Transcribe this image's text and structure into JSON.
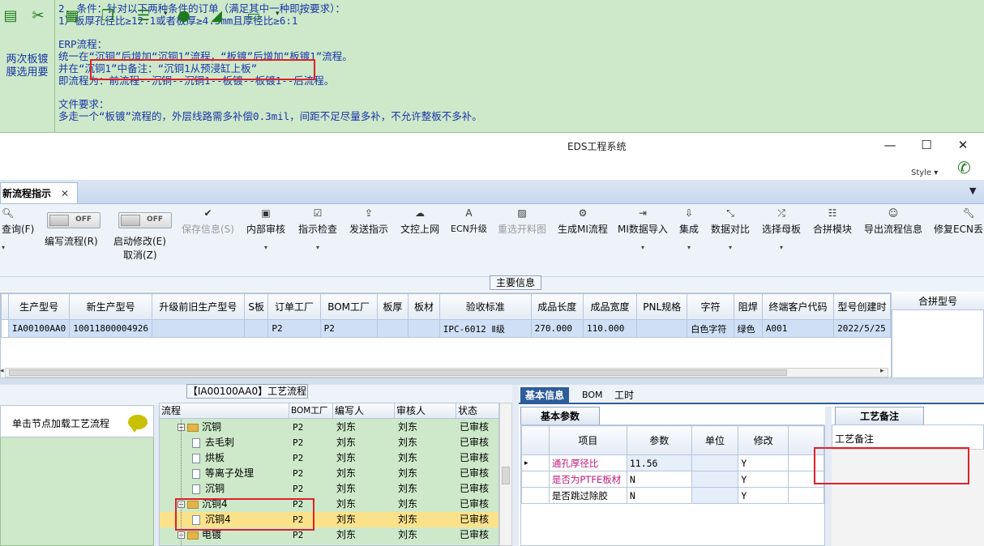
{
  "note": {
    "left_label": "两次板镀\n膜选用要",
    "lines": [
      "2. 条件：针对以下两种条件的订单（满足其中一种即按要求）：",
      "1）板厚孔径比≥12:1或者板厚≥4.5mm且厚径比≥6:1",
      "",
      "ERP流程：",
      "统一在“沉铜”后增加“沉铜1”流程，“板镀”后增加“板镀1”流程。",
      "并在“沉铜1”中备注：“沉铜1从预浸缸上板”",
      "即流程为：前流程--沉铜--沉铜1--板镀--板镀1--后流程。",
      "",
      "文件要求：",
      "多走一个“板镀”流程的，外层线路需多补偿0.3mil，间距不足尽量多补，不允许整板不多补。"
    ]
  },
  "window": {
    "title": "EDS工程系统",
    "minimize": "—",
    "maximize": "☐",
    "close": "✕",
    "style_label": "Style ▾"
  },
  "toolbar_icons": [
    "grid-icon",
    "scissors-icon",
    "film-icon",
    "copy-icon",
    "list-icon",
    "user-icon",
    "chart-icon",
    "monitor-icon"
  ],
  "tab": {
    "label": "新流程指示",
    "close": "✕"
  },
  "ribbon": {
    "query": "查询(F)",
    "edit_flow": "编写流程(R)",
    "start_modify": "启动修改(E)",
    "cancel": "取消(Z)",
    "toggle_off": "OFF",
    "save": "保存信息(S)",
    "internal_review": "内部审核",
    "check_instr": "指示检查",
    "send_instr": "发送指示",
    "doc_upload": "文控上网",
    "ecn_upgrade": "ECN升级",
    "regen_cut": "重选开料图",
    "gen_mi": "生成MI流程",
    "mi_import": "MI数据导入",
    "jicheng": "集成",
    "data_compare": "数据对比",
    "select_master": "选择母板",
    "merge_module": "合拼模块",
    "export_flow": "导出流程信息",
    "fix_ecn": "修复ECN丢"
  },
  "main_info": {
    "label": "主要信息",
    "columns": [
      "生产型号",
      "新生产型号",
      "升级前旧生产型号",
      "S板",
      "订单工厂",
      "BOM工厂",
      "板厚",
      "板材",
      "验收标准",
      "成品长度",
      "成品宽度",
      "PNL规格",
      "字符",
      "阻焊",
      "终端客户代码",
      "型号创建时"
    ],
    "row": [
      "IA00100AA0",
      "10011800004926",
      "",
      "",
      "P2",
      "P2",
      "",
      "",
      "IPC-6012 Ⅱ级",
      "270.000",
      "110.000",
      "",
      "白色字符",
      "绿色",
      "A001",
      "2022/5/25"
    ],
    "merge_header": "合拼型号"
  },
  "process": {
    "label": "【IA00100AA0】工艺流程",
    "left_hint": "单击节点加载工艺流程",
    "headers": [
      "流程",
      "BOM工厂",
      "编写人",
      "审核人",
      "状态"
    ],
    "rows": [
      {
        "name": "沉铜",
        "bom": "P2",
        "writer": "刘东",
        "reviewer": "刘东",
        "status": "已审核",
        "level": 0,
        "type": "folder"
      },
      {
        "name": "去毛刺",
        "bom": "P2",
        "writer": "刘东",
        "reviewer": "刘东",
        "status": "已审核",
        "level": 1,
        "type": "doc"
      },
      {
        "name": "烘板",
        "bom": "P2",
        "writer": "刘东",
        "reviewer": "刘东",
        "status": "已审核",
        "level": 1,
        "type": "doc"
      },
      {
        "name": "等离子处理",
        "bom": "P2",
        "writer": "刘东",
        "reviewer": "刘东",
        "status": "已审核",
        "level": 1,
        "type": "doc"
      },
      {
        "name": "沉铜",
        "bom": "P2",
        "writer": "刘东",
        "reviewer": "刘东",
        "status": "已审核",
        "level": 1,
        "type": "doc"
      },
      {
        "name": "沉铜4",
        "bom": "P2",
        "writer": "刘东",
        "reviewer": "刘东",
        "status": "已审核",
        "level": 0,
        "type": "folder"
      },
      {
        "name": "沉铜4",
        "bom": "P2",
        "writer": "刘东",
        "reviewer": "刘东",
        "status": "已审核",
        "level": 1,
        "type": "doc",
        "selected": true
      },
      {
        "name": "电镀",
        "bom": "P2",
        "writer": "刘东",
        "reviewer": "刘东",
        "status": "已审核",
        "level": 0,
        "type": "folder"
      }
    ]
  },
  "detail": {
    "tabs": [
      "基本信息",
      "BOM",
      "工时"
    ],
    "sub_tab": "基本参数",
    "param_headers": [
      "项目",
      "参数",
      "单位",
      "修改"
    ],
    "params": [
      {
        "item": "通孔厚径比",
        "value": "11.56",
        "unit": "",
        "modify": "Y"
      },
      {
        "item": "是否为PTFE板材",
        "value": "N",
        "unit": "",
        "modify": "Y"
      },
      {
        "item": "是否跳过除胶",
        "value": "N",
        "unit": "",
        "modify": "Y"
      }
    ],
    "note_tab": "工艺备注",
    "note_label": "工艺备注"
  }
}
